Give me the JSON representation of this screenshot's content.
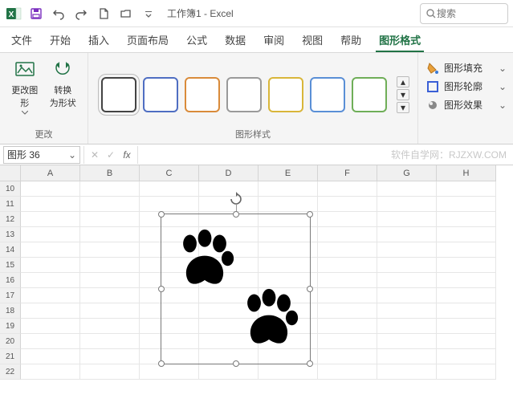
{
  "titlebar": {
    "doc_title": "工作簿1 - Excel",
    "search_placeholder": "搜索"
  },
  "tabs": {
    "file": "文件",
    "home": "开始",
    "insert": "插入",
    "layout": "页面布局",
    "formula": "公式",
    "data": "数据",
    "review": "审阅",
    "view": "视图",
    "help": "帮助",
    "shapeformat": "图形格式"
  },
  "ribbon": {
    "change_graphic": "更改图\n形",
    "convert_shape": "转换\n为形状",
    "group_change": "更改",
    "group_styles": "图形样式",
    "shape_fill": "图形填充",
    "shape_outline": "图形轮廓",
    "shape_effects": "图形效果",
    "style_colors": [
      "#444444",
      "#4f6ec2",
      "#d98b3a",
      "#9a9a9a",
      "#d9b63a",
      "#5a8fd6",
      "#6fae58"
    ]
  },
  "formula_bar": {
    "namebox": "图形 36",
    "watermark": "软件自学网：RJZXW.COM"
  },
  "grid": {
    "cols": [
      "A",
      "B",
      "C",
      "D",
      "E",
      "F",
      "G",
      "H"
    ],
    "row_start": 10,
    "row_end": 22
  },
  "shape": {
    "name": "paw-prints"
  }
}
